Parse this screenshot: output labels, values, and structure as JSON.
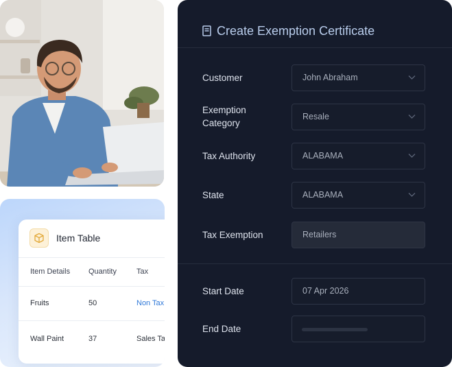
{
  "photo": {
    "subject": "man-with-laptop"
  },
  "item_table": {
    "title": "Item Table",
    "icon": "box-icon",
    "columns": [
      "Item Details",
      "Quantity",
      "Tax"
    ],
    "rows": [
      {
        "item": "Fruits",
        "quantity": "50",
        "tax": "Non Tax"
      },
      {
        "item": "Wall Paint",
        "quantity": "37",
        "tax": "Sales Ta"
      }
    ]
  },
  "form": {
    "title": "Create Exemption Certificate",
    "icon": "document-icon",
    "fields": [
      {
        "label": "Customer",
        "value": "John Abraham",
        "type": "dropdown"
      },
      {
        "label_line1": "Exemption",
        "label_line2": "Category",
        "value": "Resale",
        "type": "dropdown"
      },
      {
        "label": "Tax Authority",
        "value": "ALABAMA",
        "type": "dropdown"
      },
      {
        "label": "State",
        "value": "ALABAMA",
        "type": "dropdown"
      },
      {
        "label": "Tax Exemption",
        "value": "Retailers",
        "type": "readonly"
      }
    ],
    "start_date": {
      "label": "Start Date",
      "value": "07 Apr 2026"
    },
    "end_date": {
      "label": "End Date",
      "value": ""
    }
  },
  "colors": {
    "panel_bg": "#151b2b",
    "title": "#b9cdec",
    "link": "#2f78d8"
  }
}
